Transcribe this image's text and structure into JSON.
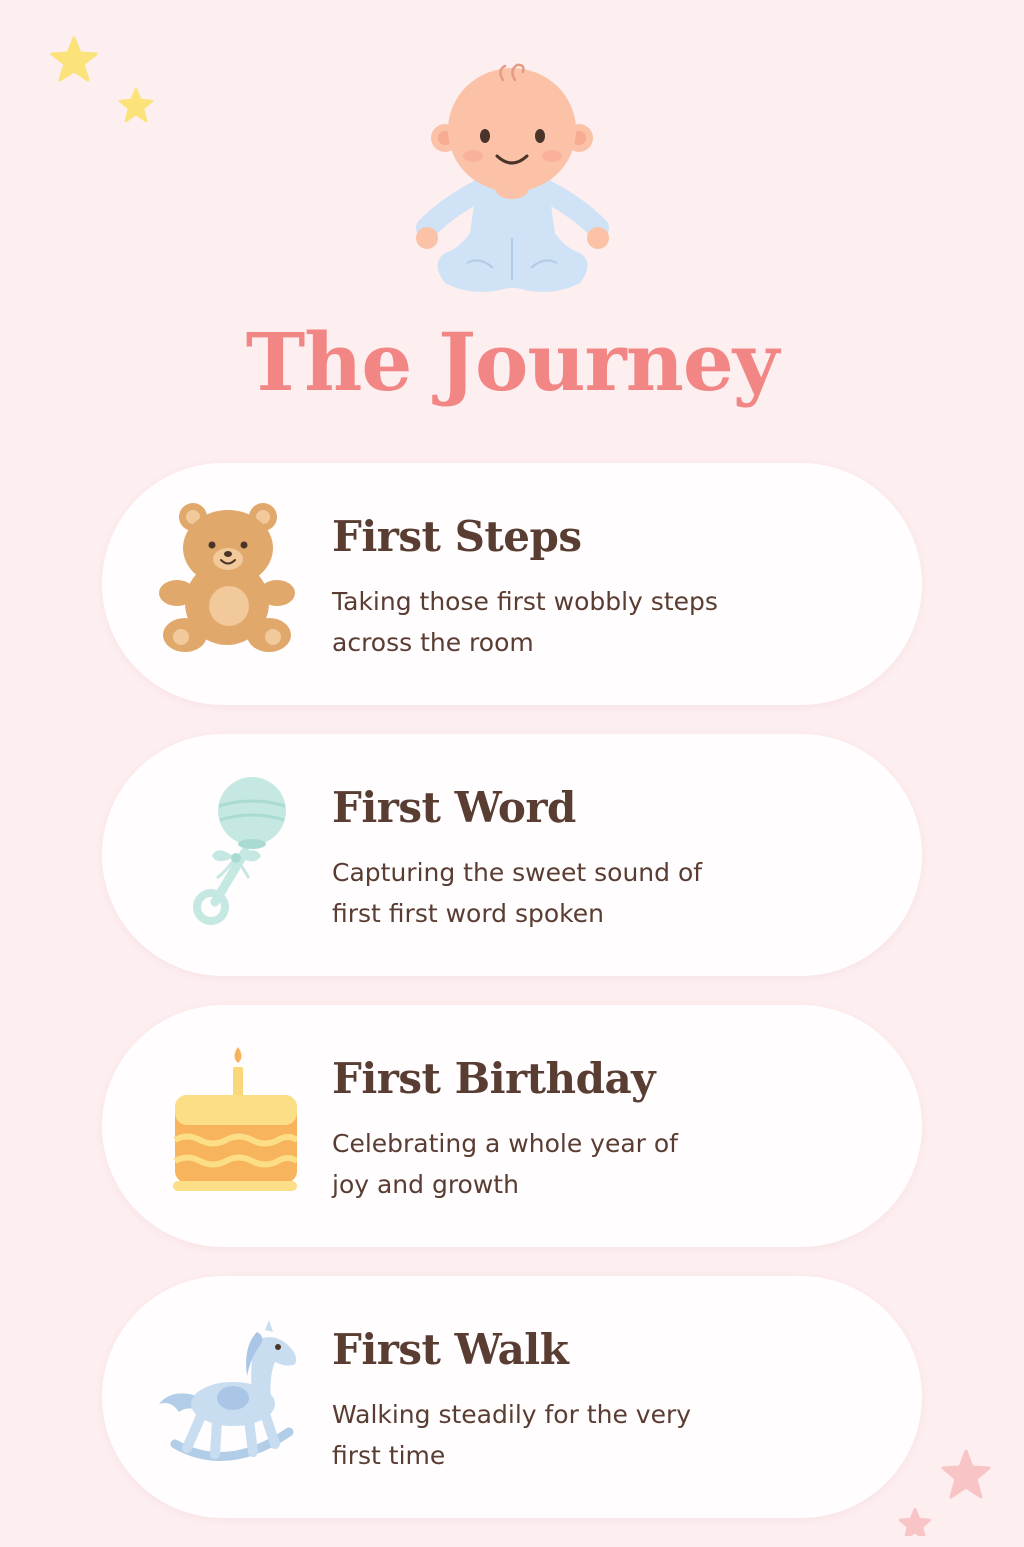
{
  "page": {
    "title": "The Journey"
  },
  "colors": {
    "background": "#fdeef0",
    "title": "#f28684",
    "card": "#fffdfd",
    "text": "#5a3d32",
    "star_yellow": "#fbe37a",
    "star_pink": "#f9c4c6"
  },
  "hero": {
    "icon": "baby-illustration"
  },
  "milestones": [
    {
      "icon": "teddy-bear-icon",
      "title": "First Steps",
      "line1": "Taking those first wobbly steps",
      "line2": "across the room"
    },
    {
      "icon": "baby-rattle-icon",
      "title": "First Word",
      "line1": "Capturing the sweet sound of",
      "line2": "first first word spoken"
    },
    {
      "icon": "birthday-cake-icon",
      "title": "First Birthday",
      "line1": "Celebrating a whole year of",
      "line2": "joy and growth"
    },
    {
      "icon": "rocking-horse-icon",
      "title": "First Walk",
      "line1": "Walking steadily for the very",
      "line2": "first time"
    }
  ]
}
